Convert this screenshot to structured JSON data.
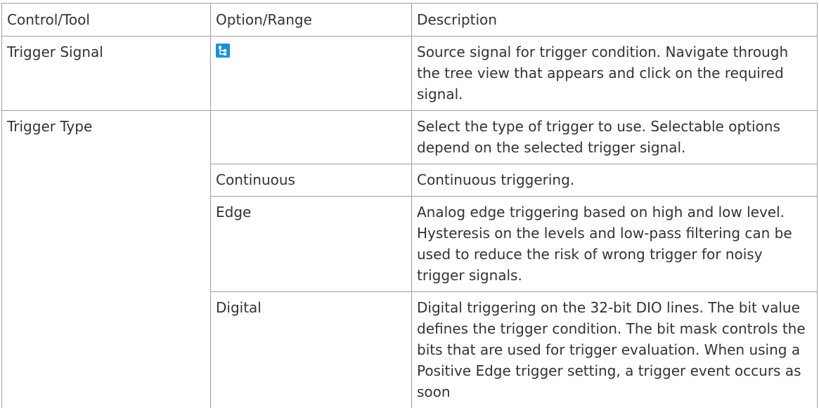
{
  "table": {
    "headers": [
      "Control/Tool",
      "Option/Range",
      "Description"
    ],
    "rows": {
      "trigger_signal": {
        "control": "Trigger Signal",
        "option_icon": "tree-view-icon",
        "description": "Source signal for trigger condition. Navigate through the tree view that appears and click on the required signal."
      },
      "trigger_type": {
        "control": "Trigger Type",
        "option": "",
        "description": "Select the type of trigger to use. Selectable options depend on the selected trigger signal."
      },
      "continuous": {
        "option": "Continuous",
        "description": "Continuous triggering."
      },
      "edge": {
        "option": "Edge",
        "description": "Analog edge triggering based on high and low level. Hysteresis on the levels and low-pass filtering can be used to reduce the risk of wrong trigger for noisy trigger signals."
      },
      "digital": {
        "option": "Digital",
        "description": "Digital triggering on the 32-bit DIO lines. The bit value defines the trigger condition. The bit mask controls the bits that are used for trigger evaluation. When using a Positive Edge trigger setting, a trigger event occurs as soon"
      }
    }
  },
  "colors": {
    "text": "#333333",
    "border": "#a0a0a0",
    "icon_blue": "#1a8fd6"
  }
}
